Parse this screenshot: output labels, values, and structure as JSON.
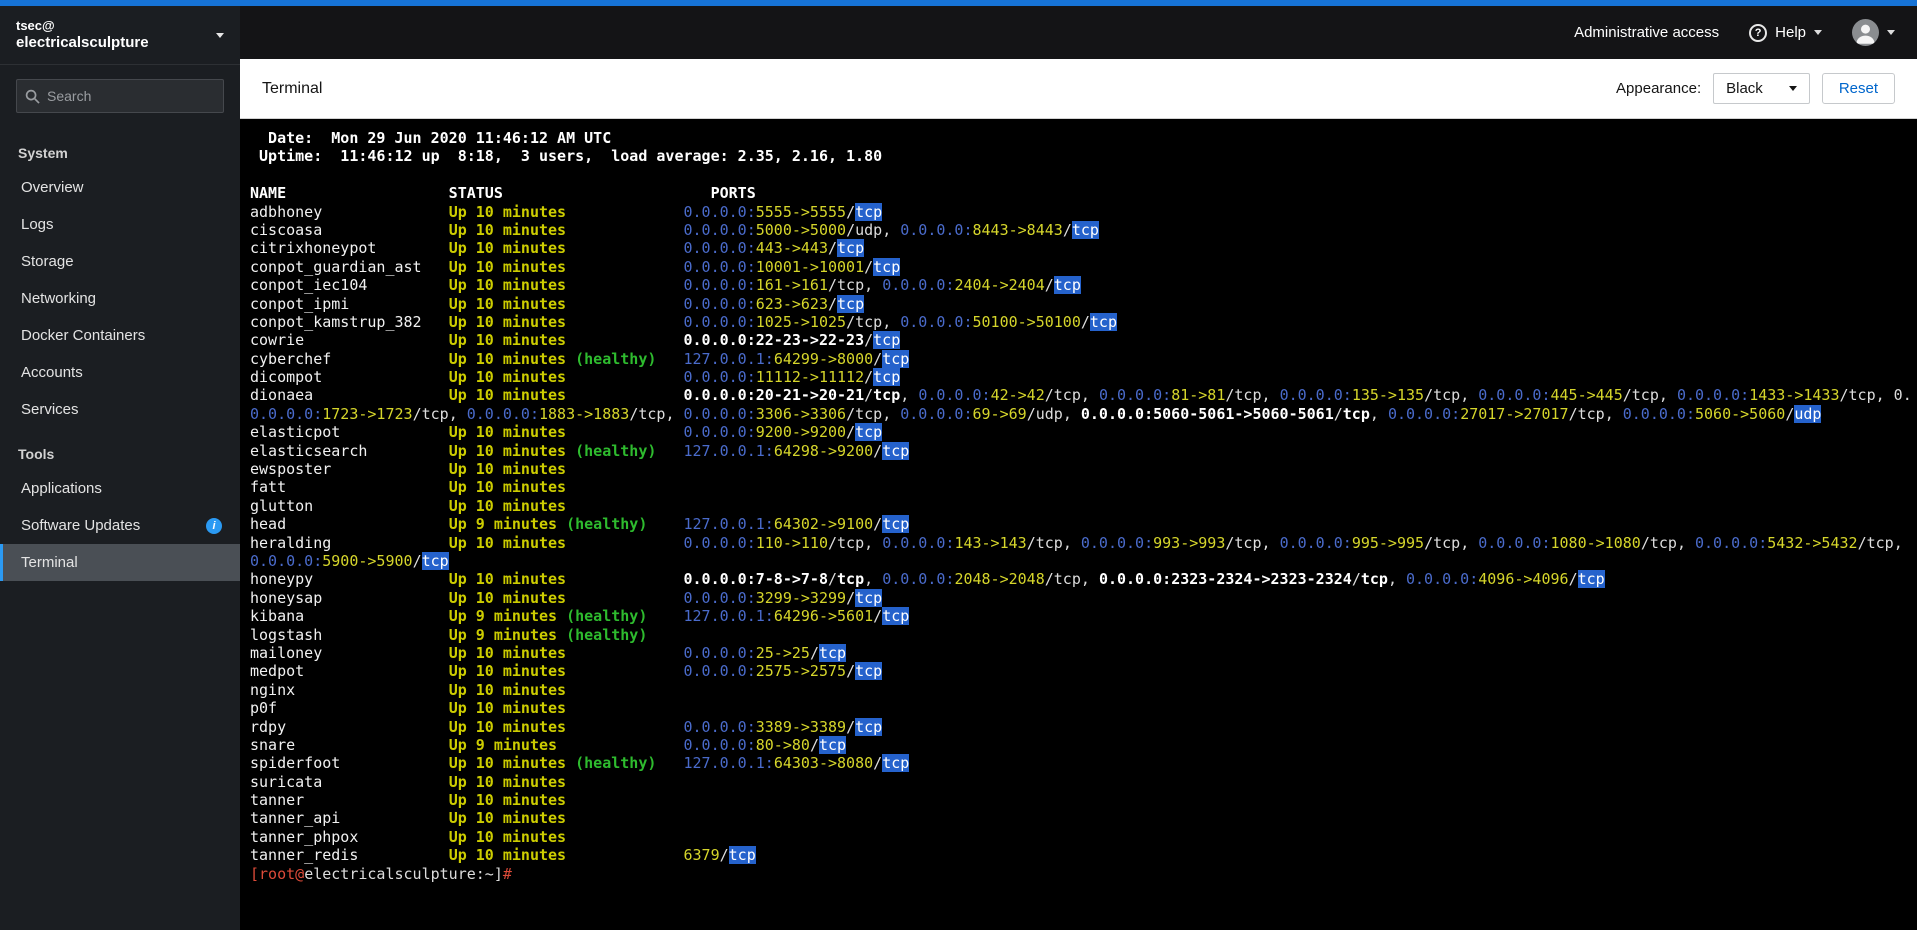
{
  "colors": {
    "accent_bar": "#1673d6",
    "link_blue": "#0066cc",
    "nav_active_blue": "#2b9af3",
    "term_status_yellow": "#cdcd00",
    "term_port_yellow": "#d6d62b",
    "term_ip_blue": "#4a6bcb",
    "term_healthy_green": "#2ebb2e",
    "term_highlight_bg": "#2562cc",
    "term_prompt_red": "#dd4b39"
  },
  "sidebar": {
    "user": "tsec@",
    "host": "electricalsculpture",
    "search_placeholder": "Search",
    "info_icon_glyph": "i",
    "sections": [
      {
        "label": "System",
        "items": [
          {
            "label": "Overview"
          },
          {
            "label": "Logs"
          },
          {
            "label": "Storage"
          },
          {
            "label": "Networking"
          },
          {
            "label": "Docker Containers"
          },
          {
            "label": "Accounts"
          },
          {
            "label": "Services"
          }
        ]
      },
      {
        "label": "Tools",
        "items": [
          {
            "label": "Applications"
          },
          {
            "label": "Software Updates",
            "info": true
          },
          {
            "label": "Terminal",
            "active": true
          }
        ]
      }
    ]
  },
  "masthead": {
    "admin_access_label": "Administrative access",
    "help_label": "Help",
    "help_icon_glyph": "?"
  },
  "toolbar": {
    "title": "Terminal",
    "appearance_label": "Appearance:",
    "appearance_value": "Black",
    "reset_label": "Reset"
  },
  "terminal": {
    "date_line": "  Date:  Mon 29 Jun 2020 11:46:12 AM UTC",
    "uptime_line": " Uptime:  11:46:12 up  8:18,  3 users,  load average: 2.35, 2.16, 1.80",
    "header_line": "NAME                  STATUS                       PORTS",
    "prompt": {
      "p1": "[root@",
      "p2": "electricalsculpture:~]",
      "p3": "#"
    },
    "rows": [
      {
        "name": "adbhoney",
        "status": "Up 10 minutes",
        "ports": [
          {
            "ip": "0.0.0.0:",
            "p": "5555->5555",
            "proto": "tcp",
            "hl": true
          }
        ]
      },
      {
        "name": "ciscoasa",
        "status": "Up 10 minutes",
        "ports": [
          {
            "ip": "0.0.0.0:",
            "p": "5000->5000",
            "proto": "udp"
          },
          {
            "ip": "0.0.0.0:",
            "p": "8443->8443",
            "proto": "tcp",
            "hl": true
          }
        ]
      },
      {
        "name": "citrixhoneypot",
        "status": "Up 10 minutes",
        "ports": [
          {
            "ip": "0.0.0.0:",
            "p": "443->443",
            "proto": "tcp",
            "hl": true
          }
        ]
      },
      {
        "name": "conpot_guardian_ast",
        "status": "Up 10 minutes",
        "ports": [
          {
            "ip": "0.0.0.0:",
            "p": "10001->10001",
            "proto": "tcp",
            "hl": true
          }
        ]
      },
      {
        "name": "conpot_iec104",
        "status": "Up 10 minutes",
        "ports": [
          {
            "ip": "0.0.0.0:",
            "p": "161->161",
            "proto": "tcp"
          },
          {
            "ip": "0.0.0.0:",
            "p": "2404->2404",
            "proto": "tcp",
            "hl": true
          }
        ]
      },
      {
        "name": "conpot_ipmi",
        "status": "Up 10 minutes",
        "ports": [
          {
            "ip": "0.0.0.0:",
            "p": "623->623",
            "proto": "tcp",
            "hl": true
          }
        ]
      },
      {
        "name": "conpot_kamstrup_382",
        "status": "Up 10 minutes",
        "ports": [
          {
            "ip": "0.0.0.0:",
            "p": "1025->1025",
            "proto": "tcp"
          },
          {
            "ip": "0.0.0.0:",
            "p": "50100->50100",
            "proto": "tcp",
            "hl": true
          }
        ]
      },
      {
        "name": "cowrie",
        "status": "Up 10 minutes",
        "ports": [
          {
            "ip": "0.0.0.0:",
            "p": "22-23->22-23",
            "proto": "tcp",
            "range": true,
            "hl": true
          }
        ]
      },
      {
        "name": "cyberchef",
        "status": "Up 10 minutes",
        "healthy": true,
        "ports": [
          {
            "ip": "127.0.0.1:",
            "p": "64299->8000",
            "proto": "tcp",
            "hl": true
          }
        ]
      },
      {
        "name": "dicompot",
        "status": "Up 10 minutes",
        "ports": [
          {
            "ip": "0.0.0.0:",
            "p": "11112->11112",
            "proto": "tcp",
            "hl": true
          }
        ]
      },
      {
        "name": "dionaea",
        "status": "Up 10 minutes",
        "trail": "0.",
        "ports": [
          {
            "ip": "0.0.0.0:",
            "p": "20-21->20-21",
            "proto": "tcp",
            "range": true
          },
          {
            "ip": "0.0.0.0:",
            "p": "42->42",
            "proto": "tcp"
          },
          {
            "ip": "0.0.0.0:",
            "p": "81->81",
            "proto": "tcp"
          },
          {
            "ip": "0.0.0.0:",
            "p": "135->135",
            "proto": "tcp"
          },
          {
            "ip": "0.0.0.0:",
            "p": "445->445",
            "proto": "tcp"
          },
          {
            "ip": "0.0.0.0:",
            "p": "1433->1433",
            "proto": "tcp"
          }
        ],
        "ports2": [
          {
            "ip": "0.0.0.0:",
            "p": "1723->1723",
            "proto": "tcp"
          },
          {
            "ip": "0.0.0.0:",
            "p": "1883->1883",
            "proto": "tcp"
          },
          {
            "ip": "0.0.0.0:",
            "p": "3306->3306",
            "proto": "tcp"
          },
          {
            "ip": "0.0.0.0:",
            "p": "69->69",
            "proto": "udp"
          },
          {
            "ip": "0.0.0.0:",
            "p": "5060-5061->5060-5061",
            "proto": "tcp",
            "range": true
          },
          {
            "ip": "0.0.0.0:",
            "p": "27017->27017",
            "proto": "tcp"
          },
          {
            "ip": "0.0.0.0:",
            "p": "5060->5060",
            "proto": "udp",
            "hl": true
          }
        ]
      },
      {
        "name": "elasticpot",
        "status": "Up 10 minutes",
        "ports": [
          {
            "ip": "0.0.0.0:",
            "p": "9200->9200",
            "proto": "tcp",
            "hl": true
          }
        ]
      },
      {
        "name": "elasticsearch",
        "status": "Up 10 minutes",
        "healthy": true,
        "ports": [
          {
            "ip": "127.0.0.1:",
            "p": "64298->9200",
            "proto": "tcp",
            "hl": true
          }
        ]
      },
      {
        "name": "ewsposter",
        "status": "Up 10 minutes"
      },
      {
        "name": "fatt",
        "status": "Up 10 minutes"
      },
      {
        "name": "glutton",
        "status": "Up 10 minutes"
      },
      {
        "name": "head",
        "status": "Up 9 minutes",
        "healthy": true,
        "ports": [
          {
            "ip": "127.0.0.1:",
            "p": "64302->9100",
            "proto": "tcp",
            "hl": true
          }
        ]
      },
      {
        "name": "heralding",
        "status": "Up 10 minutes",
        "cont": true,
        "ports": [
          {
            "ip": "0.0.0.0:",
            "p": "110->110",
            "proto": "tcp"
          },
          {
            "ip": "0.0.0.0:",
            "p": "143->143",
            "proto": "tcp"
          },
          {
            "ip": "0.0.0.0:",
            "p": "993->993",
            "proto": "tcp"
          },
          {
            "ip": "0.0.0.0:",
            "p": "995->995",
            "proto": "tcp"
          },
          {
            "ip": "0.0.0.0:",
            "p": "1080->1080",
            "proto": "tcp"
          },
          {
            "ip": "0.0.0.0:",
            "p": "5432->5432",
            "proto": "tcp"
          }
        ],
        "ports2": [
          {
            "ip": "0.0.0.0:",
            "p": "5900->5900",
            "proto": "tcp",
            "hl": true
          }
        ]
      },
      {
        "name": "honeypy",
        "status": "Up 10 minutes",
        "ports": [
          {
            "ip": "0.0.0.0:",
            "p": "7-8->7-8",
            "proto": "tcp",
            "range": true
          },
          {
            "ip": "0.0.0.0:",
            "p": "2048->2048",
            "proto": "tcp"
          },
          {
            "ip": "0.0.0.0:",
            "p": "2323-2324->2323-2324",
            "proto": "tcp",
            "range": true
          },
          {
            "ip": "0.0.0.0:",
            "p": "4096->4096",
            "proto": "tcp",
            "hl": true
          }
        ]
      },
      {
        "name": "honeysap",
        "status": "Up 10 minutes",
        "ports": [
          {
            "ip": "0.0.0.0:",
            "p": "3299->3299",
            "proto": "tcp",
            "hl": true
          }
        ]
      },
      {
        "name": "kibana",
        "status": "Up 9 minutes",
        "healthy": true,
        "ports": [
          {
            "ip": "127.0.0.1:",
            "p": "64296->5601",
            "proto": "tcp",
            "hl": true
          }
        ]
      },
      {
        "name": "logstash",
        "status": "Up 9 minutes",
        "healthy": true
      },
      {
        "name": "mailoney",
        "status": "Up 10 minutes",
        "ports": [
          {
            "ip": "0.0.0.0:",
            "p": "25->25",
            "proto": "tcp",
            "hl": true
          }
        ]
      },
      {
        "name": "medpot",
        "status": "Up 10 minutes",
        "ports": [
          {
            "ip": "0.0.0.0:",
            "p": "2575->2575",
            "proto": "tcp",
            "hl": true
          }
        ]
      },
      {
        "name": "nginx",
        "status": "Up 10 minutes"
      },
      {
        "name": "p0f",
        "status": "Up 10 minutes"
      },
      {
        "name": "rdpy",
        "status": "Up 10 minutes",
        "ports": [
          {
            "ip": "0.0.0.0:",
            "p": "3389->3389",
            "proto": "tcp",
            "hl": true
          }
        ]
      },
      {
        "name": "snare",
        "status": "Up 9 minutes",
        "ports": [
          {
            "ip": "0.0.0.0:",
            "p": "80->80",
            "proto": "tcp",
            "hl": true
          }
        ]
      },
      {
        "name": "spiderfoot",
        "status": "Up 10 minutes",
        "healthy": true,
        "ports": [
          {
            "ip": "127.0.0.1:",
            "p": "64303->8080",
            "proto": "tcp",
            "hl": true
          }
        ]
      },
      {
        "name": "suricata",
        "status": "Up 10 minutes"
      },
      {
        "name": "tanner",
        "status": "Up 10 minutes"
      },
      {
        "name": "tanner_api",
        "status": "Up 10 minutes"
      },
      {
        "name": "tanner_phpox",
        "status": "Up 10 minutes"
      },
      {
        "name": "tanner_redis",
        "status": "Up 10 minutes",
        "ports": [
          {
            "ip": "",
            "p": "6379",
            "proto": "tcp",
            "hl": true
          }
        ]
      }
    ]
  }
}
